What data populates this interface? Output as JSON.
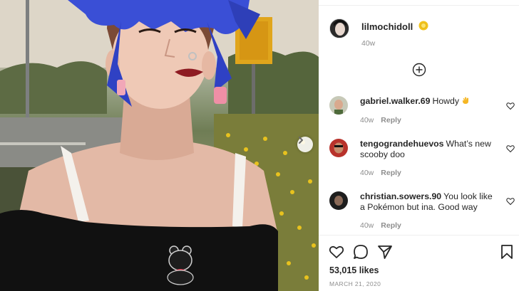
{
  "post": {
    "author": "lilmochidoll",
    "time": "40w",
    "likes": "53,015 likes",
    "date": "MARCH 21, 2020"
  },
  "comments": [
    {
      "user": "gabriel.walker.69",
      "text": "Howdy",
      "emoji": "wave-hand-icon",
      "time": "40w",
      "reply": "Reply"
    },
    {
      "user": "tengograndehuevos",
      "text": "What’s new scooby doo",
      "time": "40w",
      "reply": "Reply"
    },
    {
      "user": "christian.sowers.90",
      "text": "You look like a Pokémon but ina. Good way",
      "time": "40w",
      "reply": "Reply"
    }
  ],
  "icons": {
    "verified": "sun-badge-icon",
    "load_more": "plus-circle-icon",
    "next": "chevron-right-icon",
    "like": "heart-icon",
    "comment": "comment-bubble-icon",
    "share": "paper-plane-icon",
    "save": "bookmark-icon"
  },
  "colors": {
    "text": "#262626",
    "muted": "#8e8e8e",
    "hair": "#3a4fd6",
    "lips": "#8e1b22",
    "badge": "#f2c31a"
  }
}
